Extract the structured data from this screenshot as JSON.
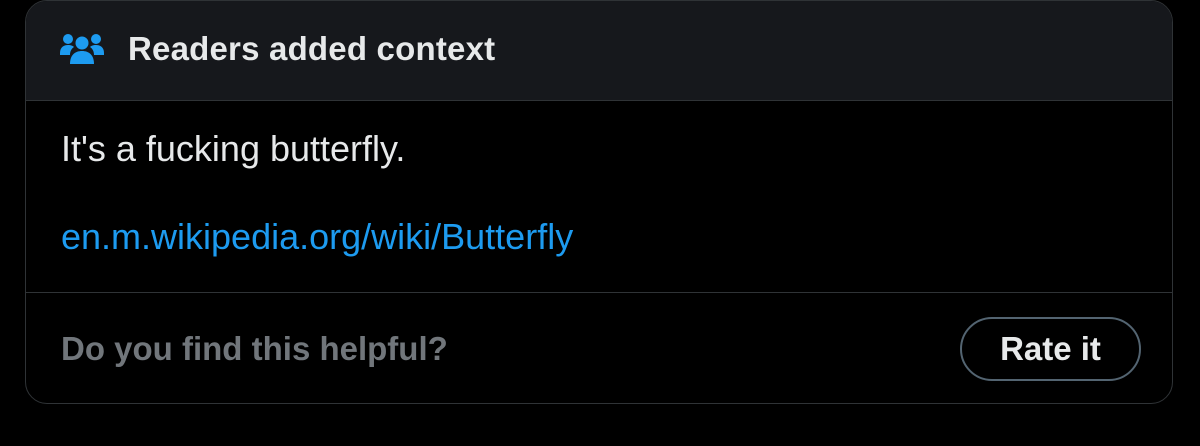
{
  "note": {
    "header_title": "Readers added context",
    "header_icon": "people-icon",
    "text": "It's a fucking butterfly.",
    "link_text": "en.m.wikipedia.org/wiki/Butterfly"
  },
  "feedback": {
    "question": "Do you find this helpful?",
    "rate_button_label": "Rate it"
  },
  "colors": {
    "accent": "#1d9bf0",
    "header_bg": "#16181c",
    "border": "#2f3336",
    "primary_text": "#e7e9ea",
    "secondary_text": "#71767b"
  }
}
